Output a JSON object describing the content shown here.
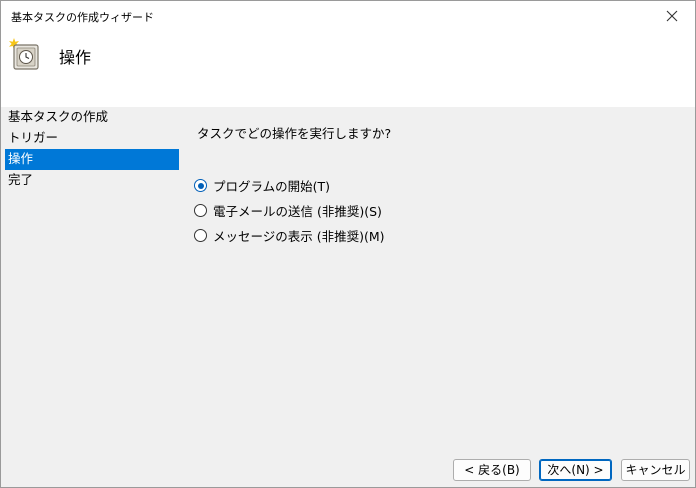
{
  "window": {
    "title": "基本タスクの作成ウィザード"
  },
  "header": {
    "title": "操作",
    "icon": "task-scheduler-clock-icon"
  },
  "steps": [
    {
      "label": "基本タスクの作成",
      "active": false
    },
    {
      "label": "トリガー",
      "active": false
    },
    {
      "label": "操作",
      "active": true
    },
    {
      "label": "完了",
      "active": false
    }
  ],
  "main": {
    "question": "タスクでどの操作を実行しますか?",
    "options": [
      {
        "label": "プログラムの開始(T)",
        "checked": true
      },
      {
        "label": "電子メールの送信 (非推奨)(S)",
        "checked": false
      },
      {
        "label": "メッセージの表示 (非推奨)(M)",
        "checked": false
      }
    ]
  },
  "buttons": {
    "back": "< 戻る(B)",
    "next": "次へ(N) >",
    "cancel": "キャンセル"
  },
  "colors": {
    "selection": "#0078d7",
    "radio_accent": "#005fb8"
  }
}
